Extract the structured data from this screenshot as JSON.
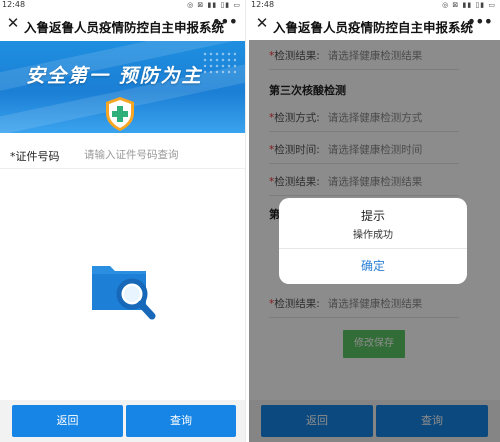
{
  "status": {
    "time": "12:48",
    "icons": "◎ ⊠ ▮▮ ▯▮ ▭"
  },
  "left": {
    "close_glyph": "✕",
    "title": "入鲁返鲁人员疫情防控自主申报系统",
    "more_glyph": "•••",
    "banner_slogan": "安全第一  预防为主",
    "id_label": "*证件号码",
    "id_placeholder": "请输入证件号码查询",
    "back_label": "返回",
    "query_label": "查询",
    "colors": {
      "primary": "#1785e6",
      "banner": "#1b7fd5"
    }
  },
  "right": {
    "close_glyph": "✕",
    "title": "入鲁返鲁人员疫情防控自主申报系统",
    "more_glyph": "•••",
    "fields": [
      {
        "req": "*",
        "label": "检测结果:",
        "value": "请选择健康检测结果"
      },
      {
        "section": "第三次核酸检测"
      },
      {
        "req": "*",
        "label": "检测方式:",
        "value": "请选择健康检测方式"
      },
      {
        "req": "*",
        "label": "检测时间:",
        "value": "请选择健康检测时间"
      },
      {
        "req": "*",
        "label": "检测结果:",
        "value": "请选择健康检测结果"
      },
      {
        "section": "第"
      },
      {
        "req": "*",
        "label": "检测结果:",
        "value": "请选择健康检测结果"
      }
    ],
    "save_label": "修改保存",
    "dialog": {
      "title": "提示",
      "message": "操作成功",
      "confirm": "确定"
    },
    "back_label": "返回",
    "query_label": "查询",
    "colors": {
      "save": "#5cc563",
      "confirm": "#2a7fd4"
    }
  }
}
